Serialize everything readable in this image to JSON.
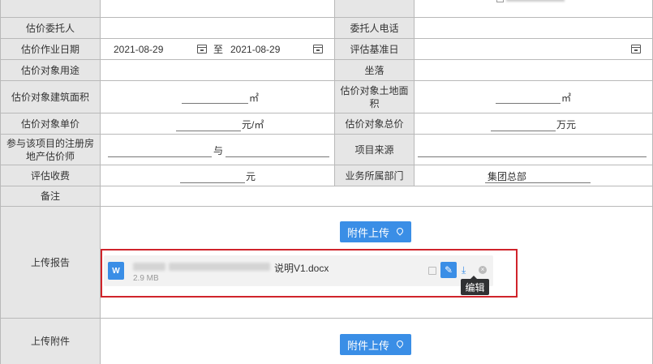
{
  "form": {
    "rows": {
      "entrust": {
        "label": "估价委托人",
        "label2": "委托人电话"
      },
      "workdate": {
        "label": "估价作业日期",
        "date_from": "2021-08-29",
        "to_text": "至",
        "date_to": "2021-08-29",
        "label2": "评估基准日"
      },
      "usage": {
        "label": "估价对象用途",
        "label2": "坐落"
      },
      "area": {
        "label": "估价对象建筑面积",
        "unit": "㎡",
        "label2": "估价对象土地面积",
        "unit2": "㎡"
      },
      "price": {
        "label": "估价对象单价",
        "unit": "元/㎡",
        "label2": "估价对象总价",
        "unit2": "万元"
      },
      "appraiser": {
        "label": "参与该项目的注册房地产估价师",
        "and_text": "与",
        "label2": "项目来源"
      },
      "fee": {
        "label": "评估收费",
        "unit": "元",
        "label2": "业务所属部门",
        "dept_value": "集团总部"
      },
      "remark": {
        "label": "备注"
      },
      "report": {
        "label": "上传报告",
        "upload_button": "附件上传"
      },
      "attachment": {
        "label": "上传附件",
        "upload_button": "附件上传"
      }
    },
    "file": {
      "icon_letter": "W",
      "name_visible": "说明V1.docx",
      "size": "2.9 MB",
      "tooltip": "编辑"
    }
  },
  "icons": [
    "calendar-icon",
    "location-pin-icon",
    "word-file-icon",
    "image-preview-icon",
    "edit-icon",
    "download-icon",
    "close-icon"
  ],
  "colors": {
    "accent": "#3a8ee6",
    "highlight_border": "#d0242b",
    "label_bg": "#e6e6e6",
    "tooltip_bg": "#303133"
  }
}
